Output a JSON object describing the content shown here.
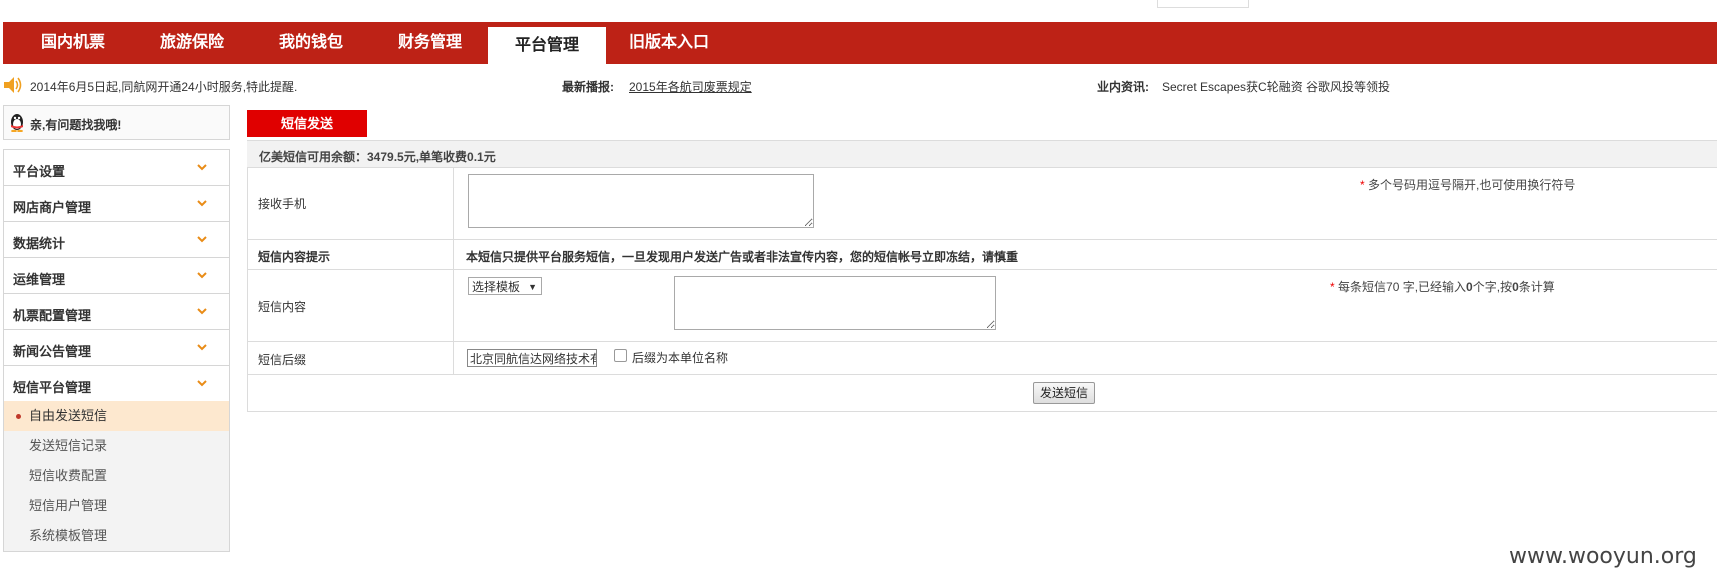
{
  "top": {
    "cut_text": "",
    "cut_box": true
  },
  "nav": {
    "items": [
      {
        "label": "国内机票"
      },
      {
        "label": "旅游保险"
      },
      {
        "label": "我的钱包"
      },
      {
        "label": "财务管理"
      },
      {
        "label": "平台管理",
        "active": true
      },
      {
        "label": "旧版本入口"
      }
    ]
  },
  "news": {
    "notice": "2014年6月5日起,同航网开通24小时服务,特此提醒.",
    "latest_label": "最新播报:",
    "latest_link": "2015年各航司废票规定",
    "industry_label": "业内资讯:",
    "industry_text": "Secret Escapes获C轮融资   谷歌风投等领投"
  },
  "sidebar": {
    "qq_label": "亲,有问题找我哦!",
    "menu": [
      {
        "label": "平台设置"
      },
      {
        "label": "网店商户管理"
      },
      {
        "label": "数据统计"
      },
      {
        "label": "运维管理"
      },
      {
        "label": "机票配置管理"
      },
      {
        "label": "新闻公告管理"
      },
      {
        "label": "短信平台管理"
      }
    ],
    "submenu": [
      {
        "label": "自由发送短信",
        "active": true
      },
      {
        "label": "发送短信记录"
      },
      {
        "label": "短信收费配置"
      },
      {
        "label": "短信用户管理"
      },
      {
        "label": "系统模板管理"
      }
    ]
  },
  "main": {
    "tab_title": "短信发送",
    "balance": "亿美短信可用余额：3479.5元,单笔收费0.1元",
    "rows": {
      "phone_label": "接收手机",
      "phone_hint_star": "*",
      "phone_hint": "多个号码用逗号隔开,也可使用换行符号",
      "tip_label": "短信内容提示",
      "tip_text": "本短信只提供平台服务短信，一旦发现用户发送广告或者非法宣传内容，您的短信帐号立即冻结，请慎重",
      "content_label": "短信内容",
      "template_select": "选择模板",
      "content_hint_star": "*",
      "content_hint_a": "每条短信70 字,已经输入",
      "content_hint_b": "0",
      "content_hint_c": "个字,按",
      "content_hint_d": "0",
      "content_hint_e": "条计算",
      "suffix_label": "短信后缀",
      "suffix_value": "北京同航信达网络技术有限",
      "suffix_checkbox_label": "后缀为本单位名称",
      "send_button": "发送短信"
    }
  },
  "watermark": "www.wooyun.org",
  "colors": {
    "brand_red": "#bd2216",
    "tab_red": "#e00000",
    "active_sub_bg": "#fde8cf",
    "chevron": "#e98c17"
  }
}
